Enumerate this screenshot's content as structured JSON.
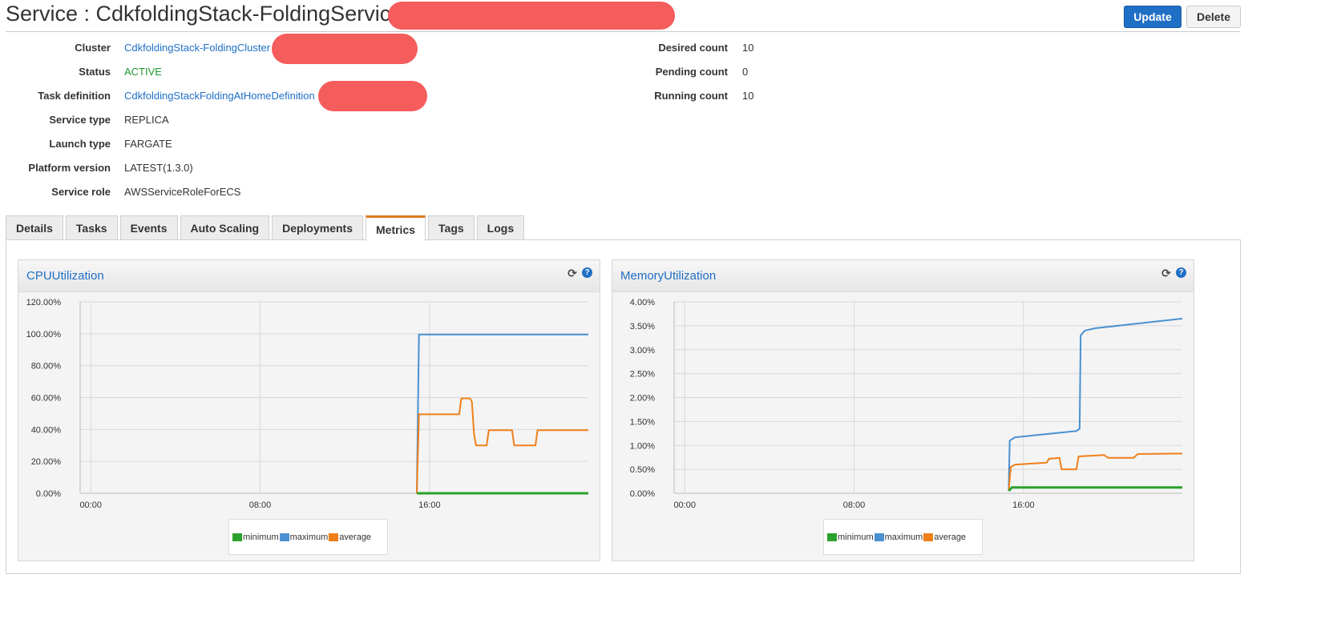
{
  "header": {
    "title": "Service : CdkfoldingStack-FoldingService",
    "update_label": "Update",
    "delete_label": "Delete"
  },
  "details_left": [
    {
      "label": "Cluster",
      "value": "CdkfoldingStack-FoldingCluster",
      "style": "link"
    },
    {
      "label": "Status",
      "value": "ACTIVE",
      "style": "ok"
    },
    {
      "label": "Task definition",
      "value": "CdkfoldingStackFoldingAtHomeDefinition",
      "style": "link"
    },
    {
      "label": "Service type",
      "value": "REPLICA",
      "style": "plain"
    },
    {
      "label": "Launch type",
      "value": "FARGATE",
      "style": "plain"
    },
    {
      "label": "Platform version",
      "value": "LATEST(1.3.0)",
      "style": "plain"
    },
    {
      "label": "Service role",
      "value": "AWSServiceRoleForECS",
      "style": "plain"
    }
  ],
  "details_right": [
    {
      "label": "Desired count",
      "value": "10"
    },
    {
      "label": "Pending count",
      "value": "0"
    },
    {
      "label": "Running count",
      "value": "10"
    }
  ],
  "tabs": [
    {
      "label": "Details"
    },
    {
      "label": "Tasks"
    },
    {
      "label": "Events"
    },
    {
      "label": "Auto Scaling"
    },
    {
      "label": "Deployments"
    },
    {
      "label": "Metrics",
      "active": true
    },
    {
      "label": "Tags"
    },
    {
      "label": "Logs"
    }
  ],
  "colors": {
    "minimum": "#2ca02c",
    "maximum": "#4a90d0",
    "average": "#f07f1a",
    "link": "#1f6fc5"
  },
  "icons": {
    "refresh": "refresh-icon",
    "help": "help-icon"
  },
  "chart_data": [
    {
      "type": "line",
      "title": "CPUUtilization",
      "x_ticks": [
        "00:00",
        "08:00",
        "16:00"
      ],
      "y_ticks": [
        "0.00%",
        "20.00%",
        "40.00%",
        "60.00%",
        "80.00%",
        "100.00%",
        "120.00%"
      ],
      "ylim": [
        0,
        120
      ],
      "xlim_hours": [
        -0.5,
        23.5
      ],
      "grid": true,
      "legend_position": "bottom-center",
      "series": [
        {
          "name": "minimum",
          "points": [
            [
              15.4,
              0
            ],
            [
              23.5,
              0
            ]
          ]
        },
        {
          "name": "maximum",
          "points": [
            [
              15.4,
              0
            ],
            [
              15.5,
              99.5
            ],
            [
              23.5,
              99.5
            ]
          ]
        },
        {
          "name": "average",
          "points": [
            [
              15.4,
              0
            ],
            [
              15.5,
              49.5
            ],
            [
              16.2,
              49.5
            ],
            [
              17.4,
              49.5
            ],
            [
              17.5,
              59.5
            ],
            [
              17.9,
              59.5
            ],
            [
              18.0,
              57.5
            ],
            [
              18.1,
              37
            ],
            [
              18.2,
              30
            ],
            [
              18.7,
              30
            ],
            [
              18.8,
              39.5
            ],
            [
              19.9,
              39.5
            ],
            [
              20.0,
              30
            ],
            [
              21.0,
              30
            ],
            [
              21.1,
              39.5
            ],
            [
              23.5,
              39.5
            ]
          ]
        }
      ]
    },
    {
      "type": "line",
      "title": "MemoryUtilization",
      "x_ticks": [
        "00:00",
        "08:00",
        "16:00"
      ],
      "y_ticks": [
        "0.00%",
        "0.50%",
        "1.00%",
        "1.50%",
        "2.00%",
        "2.50%",
        "3.00%",
        "3.50%",
        "4.00%"
      ],
      "ylim": [
        0,
        4
      ],
      "xlim_hours": [
        -0.5,
        23.5
      ],
      "grid": true,
      "legend_position": "bottom-center",
      "series": [
        {
          "name": "minimum",
          "points": [
            [
              15.3,
              0.05
            ],
            [
              15.45,
              0.12
            ],
            [
              23.5,
              0.12
            ]
          ]
        },
        {
          "name": "maximum",
          "points": [
            [
              15.3,
              0.05
            ],
            [
              15.35,
              1.1
            ],
            [
              15.6,
              1.17
            ],
            [
              18.5,
              1.3
            ],
            [
              18.65,
              1.35
            ],
            [
              18.7,
              3.3
            ],
            [
              18.9,
              3.4
            ],
            [
              19.4,
              3.45
            ],
            [
              23.5,
              3.65
            ]
          ]
        },
        {
          "name": "average",
          "points": [
            [
              15.3,
              0.05
            ],
            [
              15.4,
              0.55
            ],
            [
              15.6,
              0.6
            ],
            [
              17.1,
              0.64
            ],
            [
              17.2,
              0.72
            ],
            [
              17.7,
              0.74
            ],
            [
              17.8,
              0.5
            ],
            [
              18.5,
              0.5
            ],
            [
              18.6,
              0.77
            ],
            [
              19.8,
              0.8
            ],
            [
              20.0,
              0.74
            ],
            [
              21.2,
              0.74
            ],
            [
              21.4,
              0.82
            ],
            [
              23.5,
              0.83
            ]
          ]
        }
      ]
    }
  ]
}
